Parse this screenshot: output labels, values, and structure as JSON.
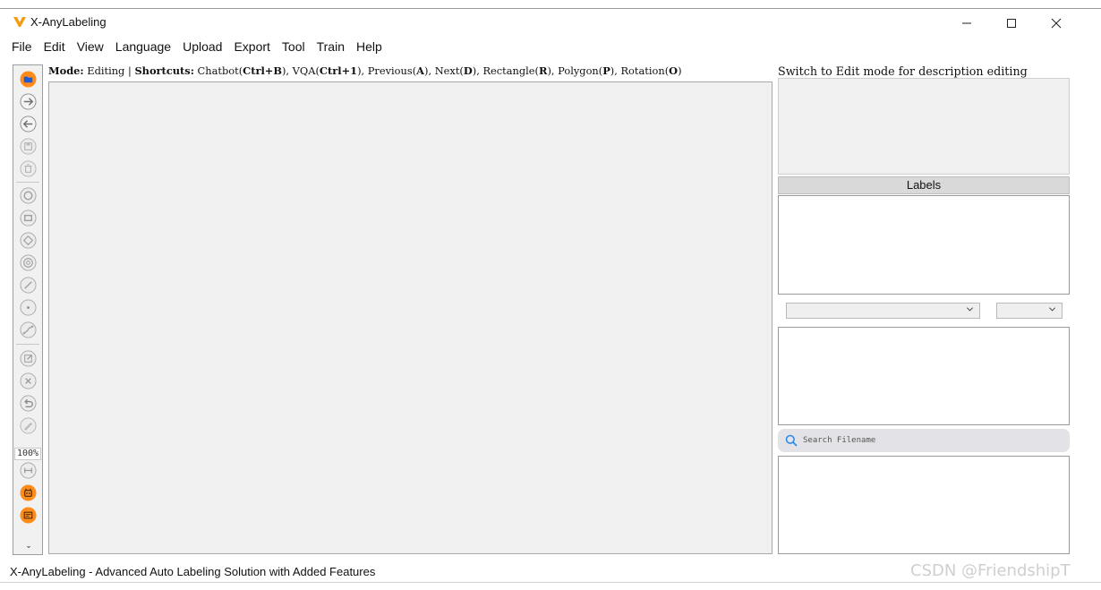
{
  "window": {
    "title": "X-AnyLabeling",
    "logo_color": "#f39c12"
  },
  "menu": [
    "File",
    "Edit",
    "View",
    "Language",
    "Upload",
    "Export",
    "Tool",
    "Train",
    "Help"
  ],
  "mode_bar": {
    "mode_label": "Mode:",
    "mode_value": "Editing",
    "separator": "|",
    "shortcuts_label": "Shortcuts:",
    "shortcuts": [
      {
        "name": "Chatbot",
        "key": "Ctrl+B"
      },
      {
        "name": "VQA",
        "key": "Ctrl+1"
      },
      {
        "name": "Previous",
        "key": "A"
      },
      {
        "name": "Next",
        "key": "D"
      },
      {
        "name": "Rectangle",
        "key": "R"
      },
      {
        "name": "Polygon",
        "key": "P"
      },
      {
        "name": "Rotation",
        "key": "O"
      }
    ]
  },
  "toolbar": {
    "zoom": "100%",
    "tools": [
      "open-folder-icon",
      "next-arrow-icon",
      "prev-arrow-icon",
      "save-icon",
      "delete-icon",
      "circle-icon",
      "rectangle-icon",
      "polygon-icon",
      "rotation-icon",
      "line-icon",
      "point-icon",
      "linestrip-icon",
      "edit-icon",
      "delete-shape-icon",
      "undo-icon",
      "brush-icon",
      "fit-width-icon",
      "auto-label-icon",
      "chatbot-icon"
    ],
    "accent": "#ff8c1a"
  },
  "right_panel": {
    "description_hint": "Switch to Edit mode for description editing",
    "labels_header": "Labels",
    "search_placeholder": "Search Filename"
  },
  "status_bar": {
    "text": "X-AnyLabeling - Advanced Auto Labeling Solution with Added Features"
  },
  "watermark": "CSDN @FriendshipT"
}
